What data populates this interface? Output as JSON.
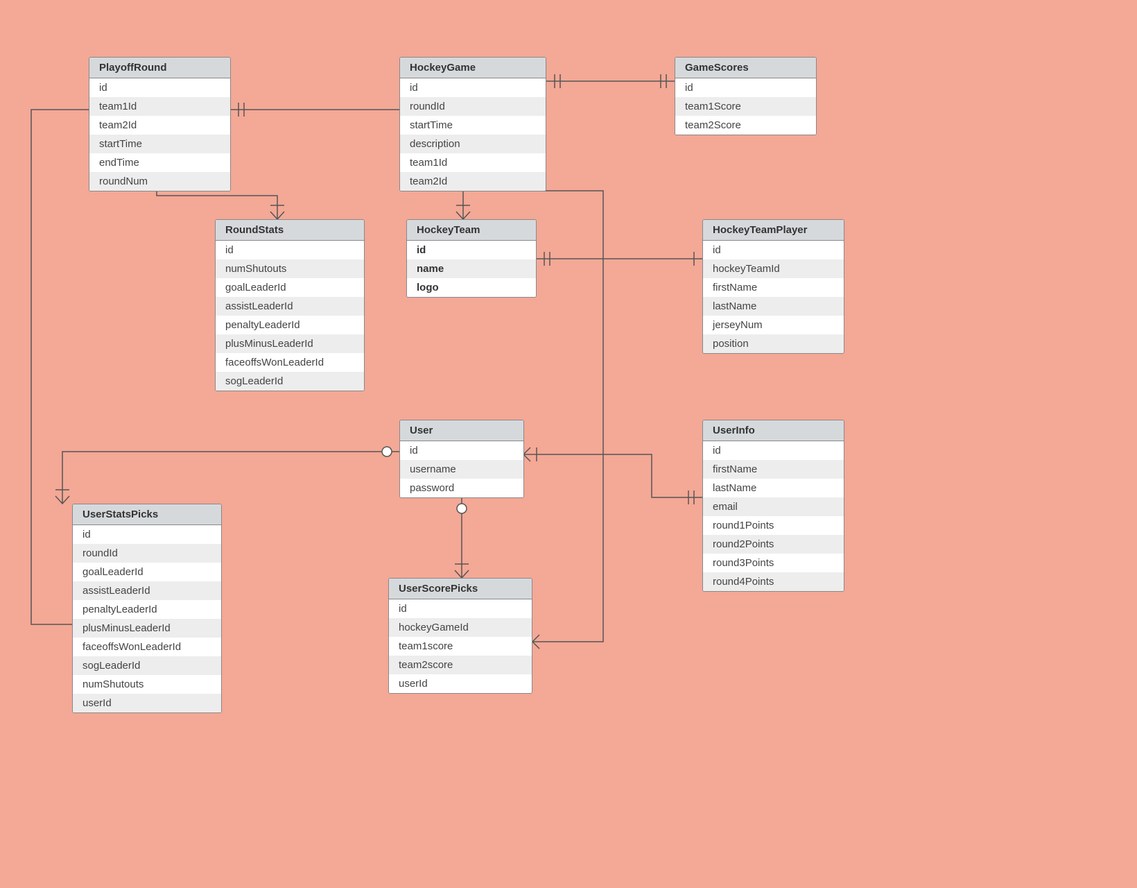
{
  "diagram_type": "entity-relationship",
  "entities": {
    "playoffRound": {
      "title": "PlayoffRound",
      "fields": [
        "id",
        "team1Id",
        "team2Id",
        "startTime",
        "endTime",
        "roundNum"
      ]
    },
    "hockeyGame": {
      "title": "HockeyGame",
      "fields": [
        "id",
        "roundId",
        "startTime",
        "description",
        "team1Id",
        "team2Id"
      ]
    },
    "gameScores": {
      "title": "GameScores",
      "fields": [
        "id",
        "team1Score",
        "team2Score"
      ]
    },
    "roundStats": {
      "title": "RoundStats",
      "fields": [
        "id",
        "numShutouts",
        "goalLeaderId",
        "assistLeaderId",
        "penaltyLeaderId",
        "plusMinusLeaderId",
        "faceoffsWonLeaderId",
        "sogLeaderId"
      ]
    },
    "hockeyTeam": {
      "title": "HockeyTeam",
      "fields": [
        "id",
        "name",
        "logo"
      ],
      "bold": true
    },
    "hockeyTeamPlayer": {
      "title": "HockeyTeamPlayer",
      "fields": [
        "id",
        "hockeyTeamId",
        "firstName",
        "lastName",
        "jerseyNum",
        "position"
      ]
    },
    "user": {
      "title": "User",
      "fields": [
        "id",
        "username",
        "password"
      ]
    },
    "userInfo": {
      "title": "UserInfo",
      "fields": [
        "id",
        "firstName",
        "lastName",
        "email",
        "round1Points",
        "round2Points",
        "round3Points",
        "round4Points"
      ]
    },
    "userStatsPicks": {
      "title": "UserStatsPicks",
      "fields": [
        "id",
        "roundId",
        "goalLeaderId",
        "assistLeaderId",
        "penaltyLeaderId",
        "plusMinusLeaderId",
        "faceoffsWonLeaderId",
        "sogLeaderId",
        "numShutouts",
        "userId"
      ]
    },
    "userScorePicks": {
      "title": "UserScorePicks",
      "fields": [
        "id",
        "hockeyGameId",
        "team1score",
        "team2score",
        "userId"
      ]
    }
  },
  "relationships": [
    {
      "from": "PlayoffRound",
      "to": "HockeyGame",
      "type": "one-to-many"
    },
    {
      "from": "HockeyGame",
      "to": "GameScores",
      "type": "one-to-one"
    },
    {
      "from": "HockeyGame",
      "to": "HockeyTeam",
      "type": "many-to-one"
    },
    {
      "from": "PlayoffRound",
      "to": "HockeyTeam",
      "type": "many-to-one"
    },
    {
      "from": "PlayoffRound",
      "to": "RoundStats",
      "type": "one-to-many"
    },
    {
      "from": "HockeyTeam",
      "to": "HockeyTeamPlayer",
      "type": "one-to-many"
    },
    {
      "from": "User",
      "to": "UserStatsPicks",
      "type": "one-to-many"
    },
    {
      "from": "User",
      "to": "UserScorePicks",
      "type": "one-to-many"
    },
    {
      "from": "User",
      "to": "UserInfo",
      "type": "one-to-one"
    },
    {
      "from": "UserScorePicks",
      "to": "HockeyGame",
      "type": "many-to-one"
    },
    {
      "from": "UserStatsPicks",
      "to": "PlayoffRound",
      "type": "many-to-one"
    }
  ]
}
